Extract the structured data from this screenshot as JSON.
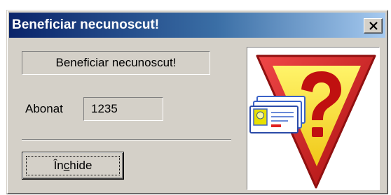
{
  "window": {
    "title": "Beneficiar necunoscut!"
  },
  "message": "Beneficiar necunoscut!",
  "subscriber": {
    "label": "Abonat",
    "value": "1235"
  },
  "buttons": {
    "close_label": "Închide",
    "close_underlined_letter": "c"
  },
  "icons": {
    "close": "close-icon",
    "warning": "unknown-beneficiary-warning-icon",
    "question": "question-mark-icon",
    "id_card": "id-card-icon"
  },
  "colors": {
    "titlebar_start": "#0a246a",
    "titlebar_end": "#a6caf0",
    "dialog_face": "#d4d0c8",
    "sign_red": "#d81818",
    "sign_yellow": "#f8e030",
    "card_blue": "#3a62c8"
  }
}
